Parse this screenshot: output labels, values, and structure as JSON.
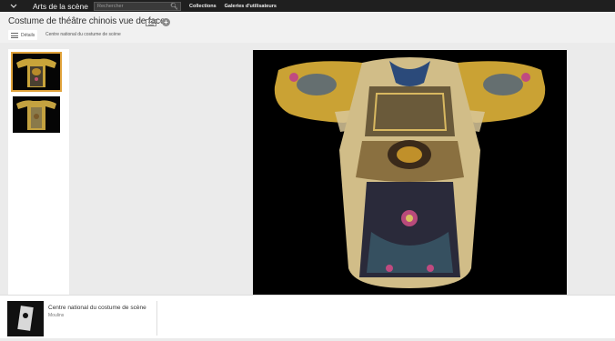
{
  "topbar": {
    "app_title": "Arts de la scène",
    "search_placeholder": "Rechercher",
    "nav": [
      "Collections",
      "Galeries d'utilisateurs"
    ]
  },
  "header": {
    "title": "Costume de théâtre chinois vue de face",
    "details_label": "Détails",
    "subtitle": "Centre national du costume de scène"
  },
  "footer": {
    "institution": "Centre national du costume de scène",
    "city": "Moulins"
  },
  "colors": {
    "topbar_bg": "#1f1f1f",
    "thumb_active": "#e0a23a",
    "artwork_bg": "#000000"
  }
}
